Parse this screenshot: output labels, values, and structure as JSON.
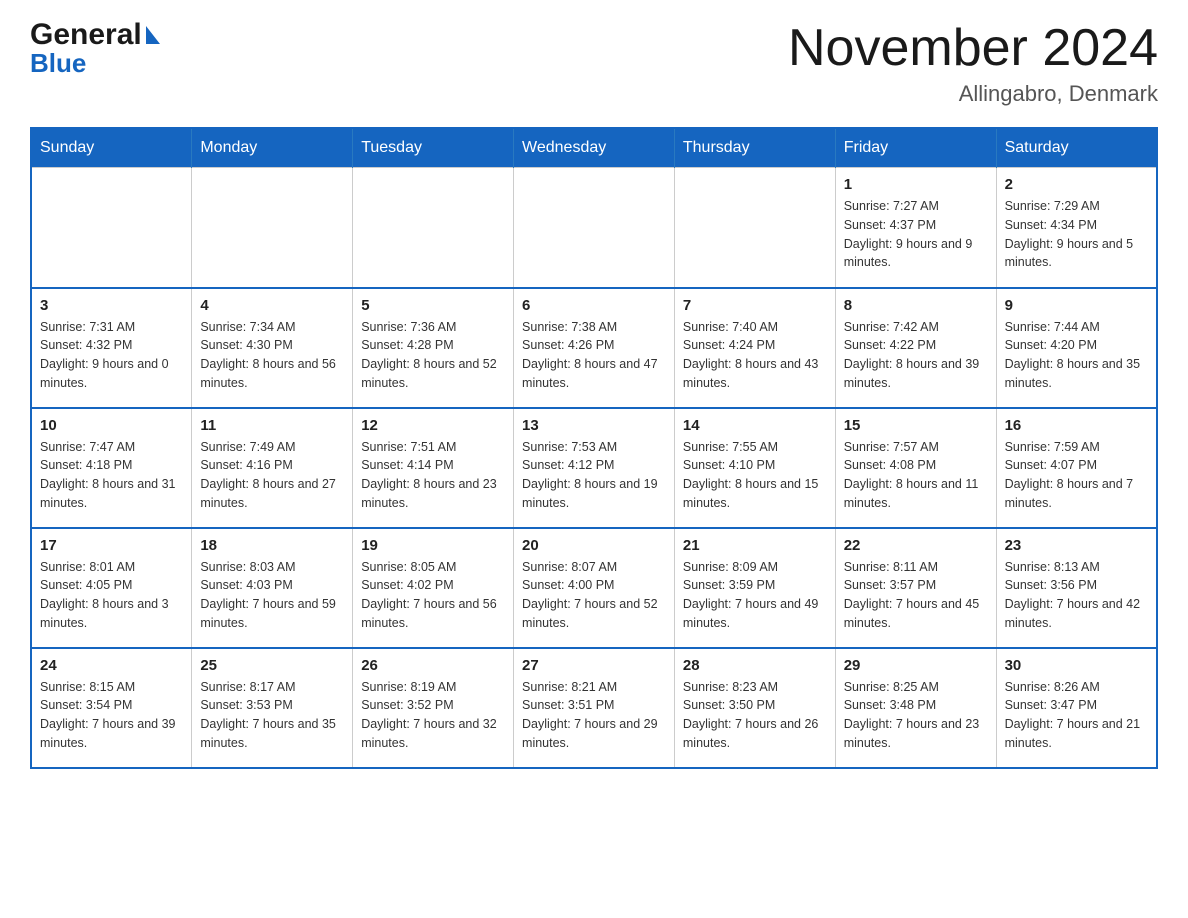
{
  "header": {
    "logo_text_black": "General",
    "logo_text_blue": "Blue",
    "month_title": "November 2024",
    "location": "Allingabro, Denmark"
  },
  "calendar": {
    "days_of_week": [
      "Sunday",
      "Monday",
      "Tuesday",
      "Wednesday",
      "Thursday",
      "Friday",
      "Saturday"
    ],
    "weeks": [
      [
        {
          "day": "",
          "info": ""
        },
        {
          "day": "",
          "info": ""
        },
        {
          "day": "",
          "info": ""
        },
        {
          "day": "",
          "info": ""
        },
        {
          "day": "",
          "info": ""
        },
        {
          "day": "1",
          "info": "Sunrise: 7:27 AM\nSunset: 4:37 PM\nDaylight: 9 hours and 9 minutes."
        },
        {
          "day": "2",
          "info": "Sunrise: 7:29 AM\nSunset: 4:34 PM\nDaylight: 9 hours and 5 minutes."
        }
      ],
      [
        {
          "day": "3",
          "info": "Sunrise: 7:31 AM\nSunset: 4:32 PM\nDaylight: 9 hours and 0 minutes."
        },
        {
          "day": "4",
          "info": "Sunrise: 7:34 AM\nSunset: 4:30 PM\nDaylight: 8 hours and 56 minutes."
        },
        {
          "day": "5",
          "info": "Sunrise: 7:36 AM\nSunset: 4:28 PM\nDaylight: 8 hours and 52 minutes."
        },
        {
          "day": "6",
          "info": "Sunrise: 7:38 AM\nSunset: 4:26 PM\nDaylight: 8 hours and 47 minutes."
        },
        {
          "day": "7",
          "info": "Sunrise: 7:40 AM\nSunset: 4:24 PM\nDaylight: 8 hours and 43 minutes."
        },
        {
          "day": "8",
          "info": "Sunrise: 7:42 AM\nSunset: 4:22 PM\nDaylight: 8 hours and 39 minutes."
        },
        {
          "day": "9",
          "info": "Sunrise: 7:44 AM\nSunset: 4:20 PM\nDaylight: 8 hours and 35 minutes."
        }
      ],
      [
        {
          "day": "10",
          "info": "Sunrise: 7:47 AM\nSunset: 4:18 PM\nDaylight: 8 hours and 31 minutes."
        },
        {
          "day": "11",
          "info": "Sunrise: 7:49 AM\nSunset: 4:16 PM\nDaylight: 8 hours and 27 minutes."
        },
        {
          "day": "12",
          "info": "Sunrise: 7:51 AM\nSunset: 4:14 PM\nDaylight: 8 hours and 23 minutes."
        },
        {
          "day": "13",
          "info": "Sunrise: 7:53 AM\nSunset: 4:12 PM\nDaylight: 8 hours and 19 minutes."
        },
        {
          "day": "14",
          "info": "Sunrise: 7:55 AM\nSunset: 4:10 PM\nDaylight: 8 hours and 15 minutes."
        },
        {
          "day": "15",
          "info": "Sunrise: 7:57 AM\nSunset: 4:08 PM\nDaylight: 8 hours and 11 minutes."
        },
        {
          "day": "16",
          "info": "Sunrise: 7:59 AM\nSunset: 4:07 PM\nDaylight: 8 hours and 7 minutes."
        }
      ],
      [
        {
          "day": "17",
          "info": "Sunrise: 8:01 AM\nSunset: 4:05 PM\nDaylight: 8 hours and 3 minutes."
        },
        {
          "day": "18",
          "info": "Sunrise: 8:03 AM\nSunset: 4:03 PM\nDaylight: 7 hours and 59 minutes."
        },
        {
          "day": "19",
          "info": "Sunrise: 8:05 AM\nSunset: 4:02 PM\nDaylight: 7 hours and 56 minutes."
        },
        {
          "day": "20",
          "info": "Sunrise: 8:07 AM\nSunset: 4:00 PM\nDaylight: 7 hours and 52 minutes."
        },
        {
          "day": "21",
          "info": "Sunrise: 8:09 AM\nSunset: 3:59 PM\nDaylight: 7 hours and 49 minutes."
        },
        {
          "day": "22",
          "info": "Sunrise: 8:11 AM\nSunset: 3:57 PM\nDaylight: 7 hours and 45 minutes."
        },
        {
          "day": "23",
          "info": "Sunrise: 8:13 AM\nSunset: 3:56 PM\nDaylight: 7 hours and 42 minutes."
        }
      ],
      [
        {
          "day": "24",
          "info": "Sunrise: 8:15 AM\nSunset: 3:54 PM\nDaylight: 7 hours and 39 minutes."
        },
        {
          "day": "25",
          "info": "Sunrise: 8:17 AM\nSunset: 3:53 PM\nDaylight: 7 hours and 35 minutes."
        },
        {
          "day": "26",
          "info": "Sunrise: 8:19 AM\nSunset: 3:52 PM\nDaylight: 7 hours and 32 minutes."
        },
        {
          "day": "27",
          "info": "Sunrise: 8:21 AM\nSunset: 3:51 PM\nDaylight: 7 hours and 29 minutes."
        },
        {
          "day": "28",
          "info": "Sunrise: 8:23 AM\nSunset: 3:50 PM\nDaylight: 7 hours and 26 minutes."
        },
        {
          "day": "29",
          "info": "Sunrise: 8:25 AM\nSunset: 3:48 PM\nDaylight: 7 hours and 23 minutes."
        },
        {
          "day": "30",
          "info": "Sunrise: 8:26 AM\nSunset: 3:47 PM\nDaylight: 7 hours and 21 minutes."
        }
      ]
    ]
  }
}
